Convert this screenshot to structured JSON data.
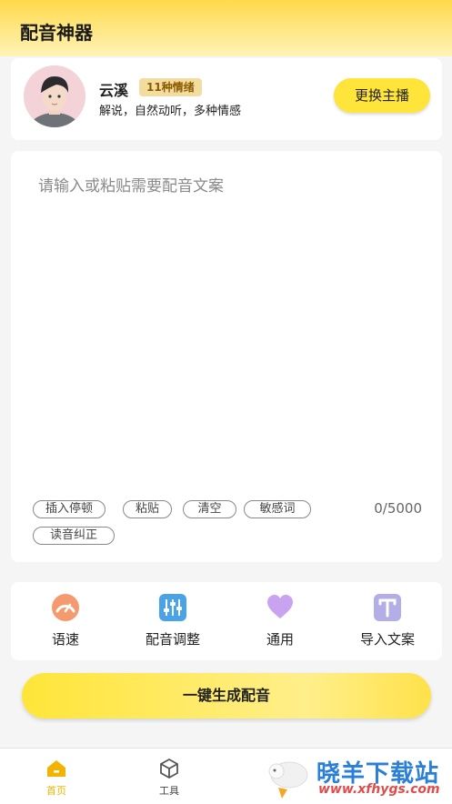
{
  "header": {
    "title": "配音神器"
  },
  "host": {
    "name": "云溪",
    "badge": "11种情绪",
    "description": "解说，自然动听，多种情感",
    "change_button": "更换主播"
  },
  "editor": {
    "placeholder": "请输入或粘贴需要配音文案",
    "value": "",
    "chips": [
      "插入停顿",
      "粘贴",
      "清空",
      "敏感词",
      "读音纠正"
    ],
    "counter": "0/5000"
  },
  "tools": [
    {
      "label": "语速",
      "icon": "speedometer-icon"
    },
    {
      "label": "配音调整",
      "icon": "sliders-icon"
    },
    {
      "label": "通用",
      "icon": "heart-icon"
    },
    {
      "label": "导入文案",
      "icon": "text-import-icon"
    }
  ],
  "generate_button": "一键生成配音",
  "tabbar": [
    {
      "label": "首页",
      "icon": "home-icon",
      "active": true
    },
    {
      "label": "工具",
      "icon": "tools-icon",
      "active": false
    }
  ],
  "watermark": {
    "text": "晓羊下载站",
    "url": "www.xfhygs.com"
  },
  "colors": {
    "accent": "#ffe43a",
    "active_tab": "#f2b400"
  }
}
